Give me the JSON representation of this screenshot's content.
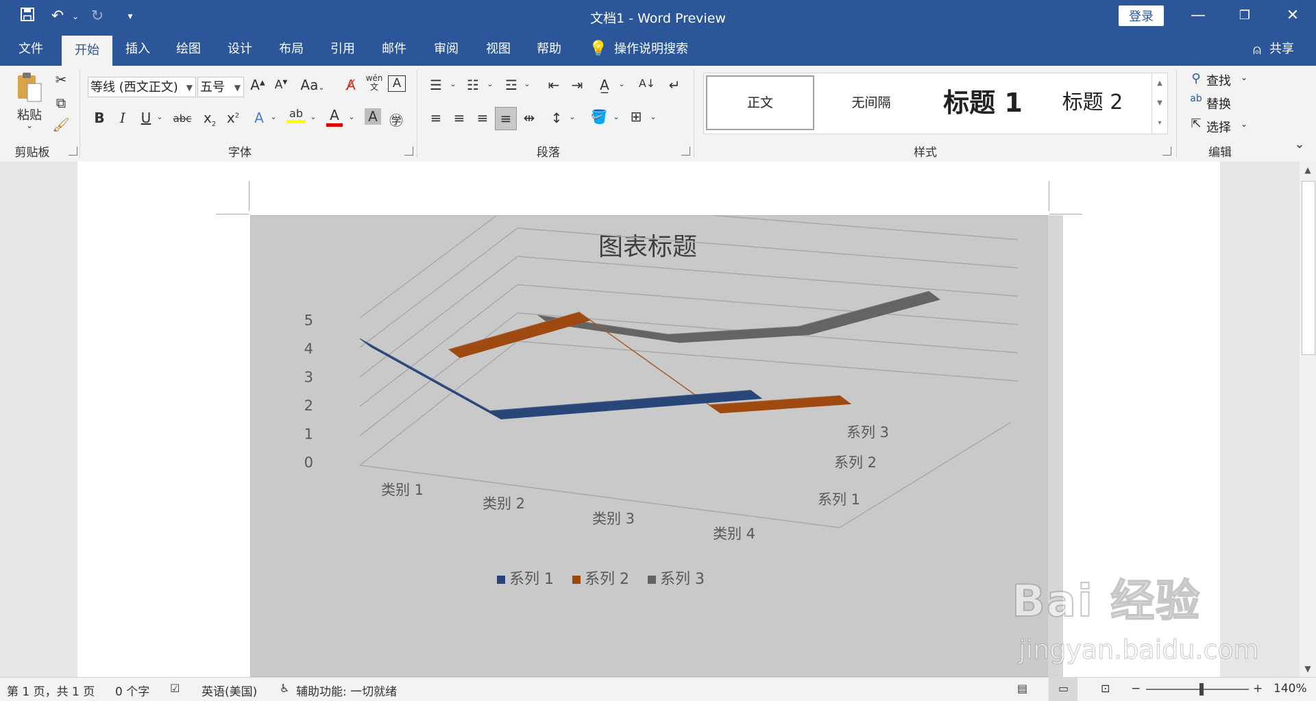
{
  "window": {
    "title": "文档1  -  Word Preview",
    "login_label": "登录",
    "share_label": "共享"
  },
  "menu_tabs": [
    "文件",
    "开始",
    "插入",
    "绘图",
    "设计",
    "布局",
    "引用",
    "邮件",
    "审阅",
    "视图",
    "帮助"
  ],
  "tell_me": "操作说明搜索",
  "ribbon": {
    "clipboard": {
      "paste_label": "粘贴",
      "group_label": "剪贴板"
    },
    "font": {
      "font_name": "等线 (西文正文)",
      "font_size": "五号",
      "group_label": "字体",
      "case_label": "Aa",
      "pinyin_label": "wén 文"
    },
    "paragraph": {
      "group_label": "段落"
    },
    "styles": {
      "group_label": "样式",
      "items": [
        "正文",
        "无间隔",
        "标题 1",
        "标题 2"
      ]
    },
    "editing": {
      "group_label": "编辑",
      "find_label": "查找",
      "replace_label": "替换",
      "select_label": "选择"
    }
  },
  "chart_data": {
    "type": "line",
    "variant": "3d-line",
    "title": "图表标题",
    "categories": [
      "类别 1",
      "类别 2",
      "类别 3",
      "类别 4"
    ],
    "series": [
      {
        "name": "系列 1",
        "values": [
          4.3,
          2.5,
          3.5,
          4.5
        ],
        "color": "#264478"
      },
      {
        "name": "系列 2",
        "values": [
          2.4,
          4.4,
          1.8,
          2.8
        ],
        "color": "#9e480e"
      },
      {
        "name": "系列 3",
        "values": [
          2,
          2,
          3,
          5
        ],
        "color": "#636363"
      }
    ],
    "ylim": [
      0,
      5
    ],
    "yticks": [
      "0",
      "1",
      "2",
      "3",
      "4",
      "5"
    ],
    "depth_labels": [
      "系列 1",
      "系列 2",
      "系列 3"
    ],
    "legend_position": "bottom",
    "background": "#c9c9c9"
  },
  "status": {
    "page": "第 1 页，共 1 页",
    "words": "0 个字",
    "language": "英语(美国)",
    "accessibility": "辅助功能: 一切就绪",
    "zoom": "140%"
  },
  "watermark": {
    "text_top": "Bai 经验",
    "text_bottom": "jingyan.baidu.com"
  }
}
